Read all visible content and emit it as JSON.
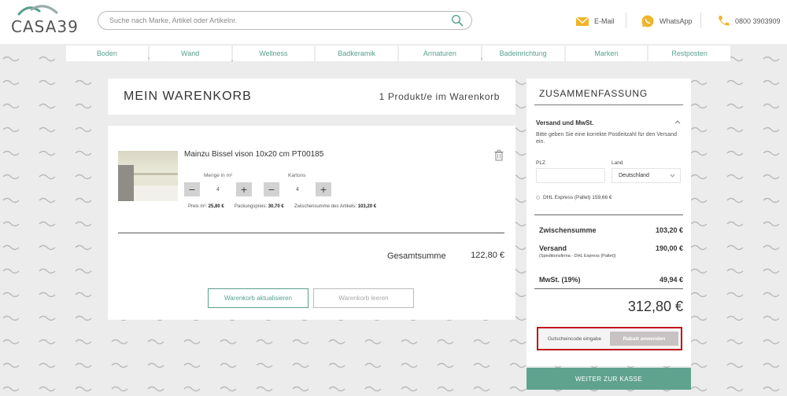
{
  "brand": {
    "logo_text": "CASA39",
    "accent": "#57a08e"
  },
  "search": {
    "placeholder": "Suche nach Marke, Artikel oder Artikelnr.",
    "icon": "search-icon"
  },
  "contact": {
    "email": "E-Mail",
    "whatsapp": "WhatsApp",
    "phone": "0800 3903909"
  },
  "nav": [
    "Boden",
    "Wand",
    "Wellness",
    "Badkeramik",
    "Armaturen",
    "Badeinrichtung",
    "Marken",
    "Restposten"
  ],
  "cart": {
    "title": "MEIN WARENKORB",
    "count_text": "1 Produkt/e im Warenkorb",
    "item": {
      "name": "Mainzu Bissel vison 10x20 cm PT00185",
      "qty_m2_label": "Menge in m²",
      "qty_m2": "4",
      "cartons_label": "Kartons",
      "cartons": "4",
      "price_m2_label": "Preis m²:",
      "price_m2": "25,80 €",
      "pack_label": "Packungspreis:",
      "pack_price": "30,70 €",
      "subtotal_label": "Zwischensumme des Artikels:",
      "subtotal": "103,20 €"
    },
    "total_label": "Gesamtsumme",
    "total_value": "122,80 €",
    "update_button": "Warenkorb aktualisieren",
    "clear_button": "Warenkorb leeren"
  },
  "summary": {
    "title": "ZUSAMMENFASSUNG",
    "shipping_head": "Versand und MwSt.",
    "shipping_info": "Bitte geben Sie eine korrekte Postleitzahl für den Versand ein.",
    "plz_label": "PLZ",
    "land_label": "Land",
    "land_value": "Deutschland",
    "shipping_option": "DHL Express (Pallet) 159,66 €",
    "subtotal_label": "Zwischensumme",
    "subtotal_value": "103,20 €",
    "versand_label": "Versand",
    "versand_value": "190,00 €",
    "versand_sub": "(Speditionsfirma - DHL Express (Pallet))",
    "tax_label": "MwSt. (19%)",
    "tax_value": "49,94 €",
    "grand_total": "312,80 €",
    "coupon_placeholder": "Gutscheincode eingabe",
    "coupon_button": "Rabatt anwenden",
    "checkout_button": "WEITER ZUR KASSE"
  }
}
